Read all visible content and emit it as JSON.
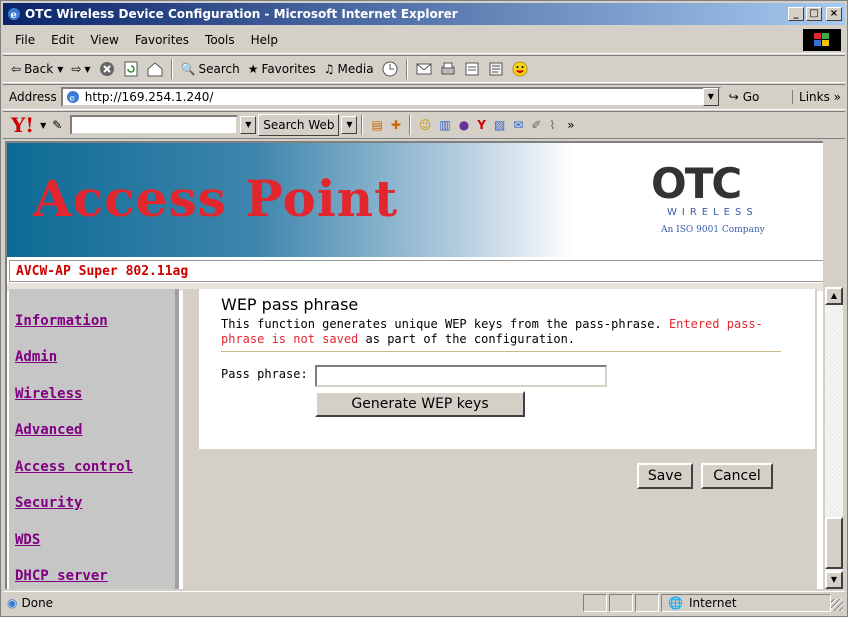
{
  "window": {
    "title": "OTC Wireless Device Configuration - Microsoft Internet Explorer",
    "min_label": "_",
    "max_label": "□",
    "close_label": "×"
  },
  "menubar": {
    "items": [
      "File",
      "Edit",
      "View",
      "Favorites",
      "Tools",
      "Help"
    ]
  },
  "toolbar": {
    "back_label": "Back",
    "search_label": "Search",
    "favorites_label": "Favorites",
    "media_label": "Media"
  },
  "address": {
    "label": "Address",
    "url": "http://169.254.1.240/",
    "go_label": "Go",
    "links_label": "Links"
  },
  "yahoo": {
    "logo": "Y!",
    "search_web_label": "Search Web"
  },
  "page": {
    "banner_title": "Access Point",
    "otc_logo": "OTC",
    "otc_wireless": "WIRELESS",
    "otc_iso": "An ISO 9001 Company",
    "model": "AVCW-AP Super 802.11ag",
    "nav": [
      "Information",
      "Admin",
      "Wireless",
      "Advanced",
      "Access control",
      "Security",
      "WDS",
      "DHCP server"
    ],
    "section_title": "WEP pass phrase",
    "desc_normal_1": "This function generates unique WEP keys from the pass-phrase.",
    "desc_warning": "Entered pass-phrase is not saved",
    "desc_normal_2": "as part of the configuration.",
    "pass_label": "Pass phrase:",
    "pass_value": "",
    "generate_label": "Generate WEP keys",
    "save_label": "Save",
    "cancel_label": "Cancel"
  },
  "status": {
    "text": "Done",
    "zone": "Internet"
  },
  "colors": {
    "title_accent": "#e3262e",
    "link": "#800080",
    "titlebar": "#0a246a"
  }
}
